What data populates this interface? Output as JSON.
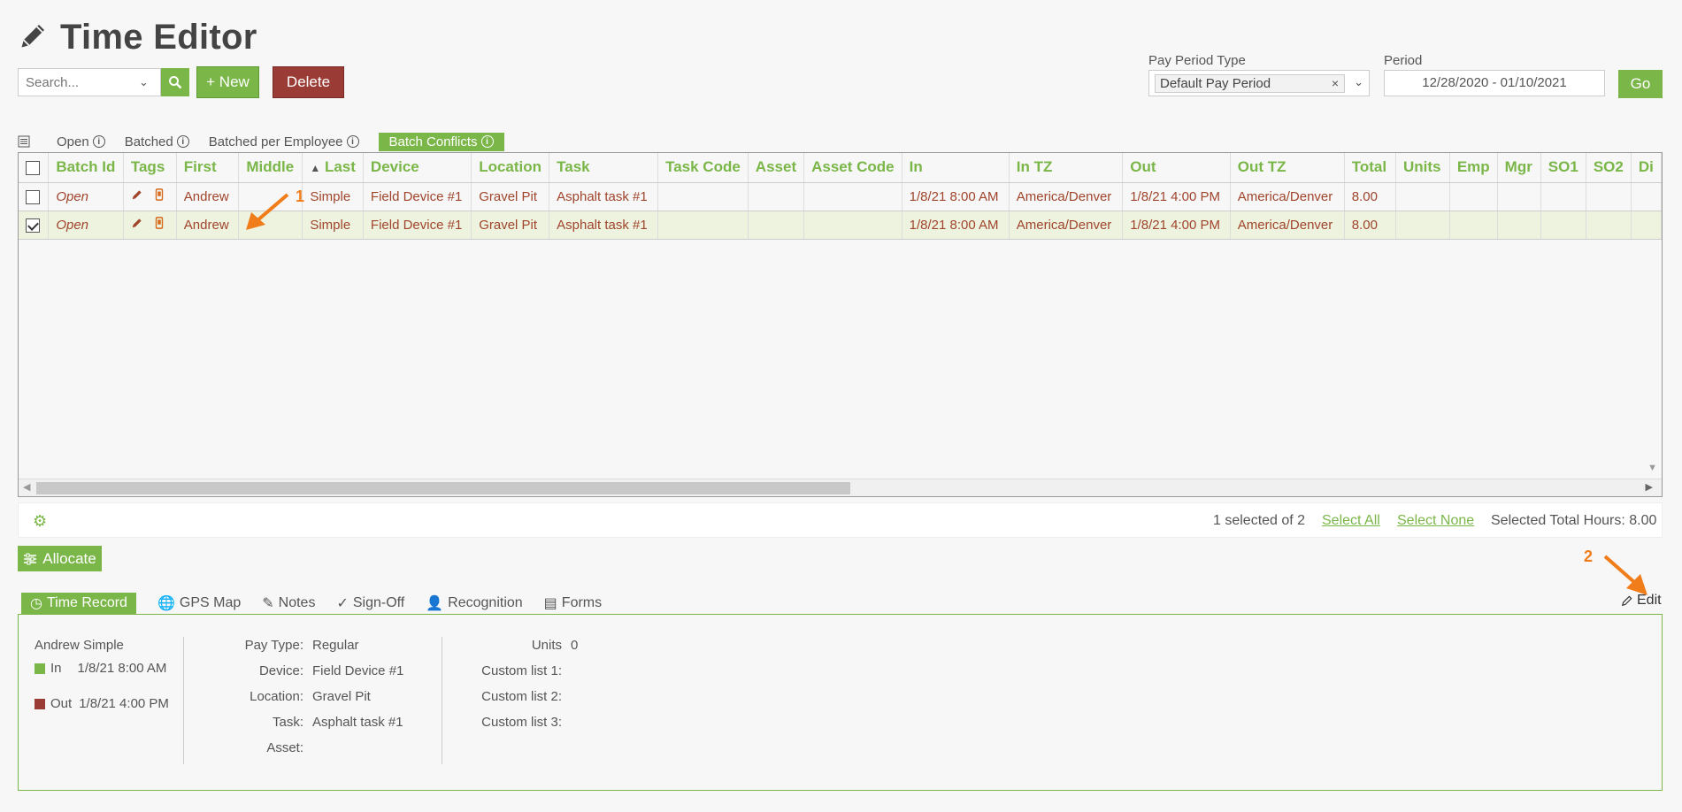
{
  "header": {
    "title": "Time Editor"
  },
  "toolbar": {
    "search_placeholder": "Search...",
    "new_label": "+ New",
    "delete_label": "Delete",
    "pay_period_type_label": "Pay Period Type",
    "pay_period_type_value": "Default Pay Period",
    "period_label": "Period",
    "period_value": "12/28/2020 - 01/10/2021",
    "go_label": "Go"
  },
  "grid_tabs": [
    {
      "label": "Open"
    },
    {
      "label": "Batched"
    },
    {
      "label": "Batched per Employee"
    },
    {
      "label": "Batch Conflicts"
    }
  ],
  "table": {
    "columns": [
      "Batch Id",
      "Tags",
      "First",
      "Middle",
      "Last",
      "Device",
      "Location",
      "Task",
      "Task Code",
      "Asset",
      "Asset Code",
      "In",
      "In TZ",
      "Out",
      "Out TZ",
      "Total",
      "Units",
      "Emp",
      "Mgr",
      "SO1",
      "SO2",
      "Di"
    ],
    "rows": [
      {
        "checked": false,
        "cells": [
          "Open",
          "",
          "Andrew",
          "",
          "Simple",
          "Field Device #1",
          "Gravel Pit",
          "Asphalt task #1",
          "",
          "",
          "",
          "1/8/21 8:00 AM",
          "America/Denver",
          "1/8/21 4:00 PM",
          "America/Denver",
          "8.00",
          "",
          "",
          "",
          "",
          "",
          ""
        ]
      },
      {
        "checked": true,
        "cells": [
          "Open",
          "",
          "Andrew",
          "",
          "Simple",
          "Field Device #1",
          "Gravel Pit",
          "Asphalt task #1",
          "",
          "",
          "",
          "1/8/21 8:00 AM",
          "America/Denver",
          "1/8/21 4:00 PM",
          "America/Denver",
          "8.00",
          "",
          "",
          "",
          "",
          "",
          ""
        ]
      }
    ]
  },
  "footer": {
    "selected_count": "1 selected of 2",
    "select_all": "Select All",
    "select_none": "Select None",
    "selected_total": "Selected Total Hours: 8.00"
  },
  "allocate_label": "Allocate",
  "detail_tabs": [
    {
      "label": "Time Record"
    },
    {
      "label": "GPS Map"
    },
    {
      "label": "Notes"
    },
    {
      "label": "Sign-Off"
    },
    {
      "label": "Recognition"
    },
    {
      "label": "Forms"
    }
  ],
  "edit_label": "Edit",
  "detail": {
    "name": "Andrew Simple",
    "in_label": "In",
    "in_time": "1/8/21 8:00 AM",
    "out_label": "Out",
    "out_time": "1/8/21 4:00 PM",
    "pay_type_k": "Pay Type:",
    "pay_type_v": "Regular",
    "device_k": "Device:",
    "device_v": "Field Device #1",
    "location_k": "Location:",
    "location_v": "Gravel Pit",
    "task_k": "Task:",
    "task_v": "Asphalt task #1",
    "asset_k": "Asset:",
    "asset_v": "",
    "units_k": "Units",
    "units_v": "0",
    "custom1_k": "Custom list 1:",
    "custom2_k": "Custom list 2:",
    "custom3_k": "Custom list 3:"
  },
  "annotations": {
    "one": "1",
    "two": "2"
  },
  "colors": {
    "accent": "#7ab648",
    "danger": "#9b3b36",
    "cell_text": "#a0452c",
    "annotation": "#f07c1a"
  }
}
